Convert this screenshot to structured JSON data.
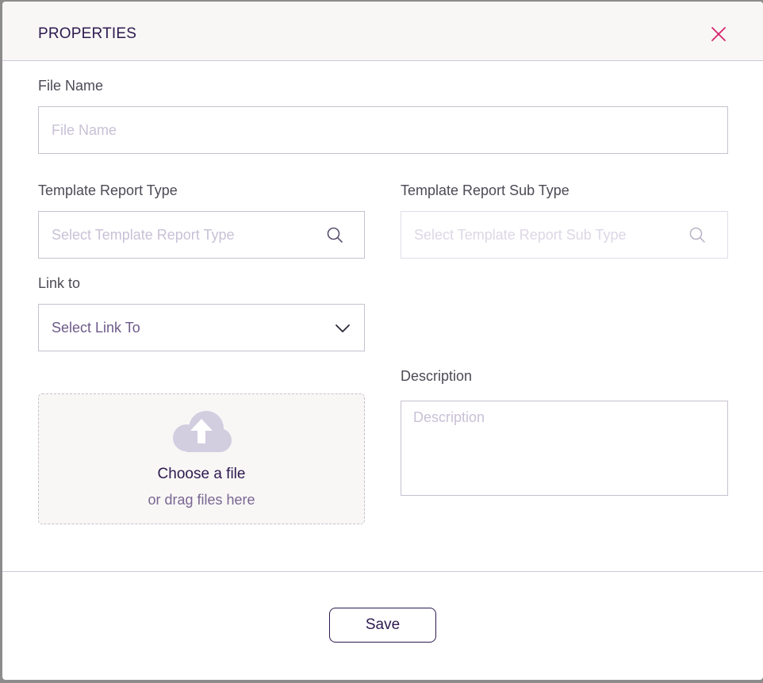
{
  "dialog": {
    "title": "PROPERTIES"
  },
  "file_name": {
    "label": "File Name",
    "placeholder": "File Name",
    "value": ""
  },
  "template_report_type": {
    "label": "Template Report Type",
    "placeholder": "Select Template Report Type"
  },
  "template_report_sub_type": {
    "label": "Template Report Sub Type",
    "placeholder": "Select Template Report Sub Type",
    "disabled": true
  },
  "link_to": {
    "label": "Link to",
    "selected": "Select Link To"
  },
  "upload": {
    "title": "Choose a file",
    "subtitle": "or drag files here"
  },
  "description": {
    "label": "Description",
    "placeholder": "Description",
    "value": ""
  },
  "footer": {
    "save_label": "Save"
  },
  "icons": {
    "close": "close-icon",
    "search": "search-icon",
    "dropdown": "chevron-down-icon",
    "upload": "cloud-upload-icon"
  },
  "colors": {
    "primary": "#2e1a4f",
    "close_accent": "#d6246e",
    "upload_icon": "#d3cde0",
    "border": "#c7c1cf",
    "header_bg": "#f8f7f5"
  }
}
